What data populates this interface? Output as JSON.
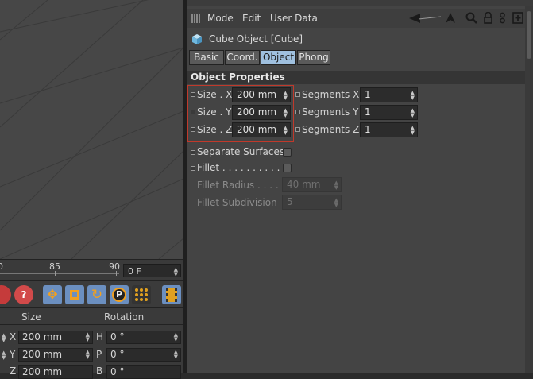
{
  "menubar": {
    "items": [
      "Mode",
      "Edit",
      "User Data"
    ]
  },
  "object_header": {
    "title": "Cube Object [Cube]"
  },
  "tabs": [
    {
      "label": "Basic",
      "active": false
    },
    {
      "label": "Coord.",
      "active": false
    },
    {
      "label": "Object",
      "active": true
    },
    {
      "label": "Phong",
      "active": false
    }
  ],
  "section": {
    "title": "Object Properties"
  },
  "size": {
    "x_label": "Size . X",
    "x_value": "200 mm",
    "y_label": "Size . Y",
    "y_value": "200 mm",
    "z_label": "Size . Z",
    "z_value": "200 mm"
  },
  "segments": {
    "x_label": "Segments X",
    "x_value": "1",
    "y_label": "Segments Y",
    "y_value": "1",
    "z_label": "Segments Z",
    "z_value": "1"
  },
  "options": {
    "separate_surfaces_label": "Separate Surfaces",
    "fillet_label": "Fillet . . . . . . . . . . . .",
    "fillet_radius_label": "Fillet Radius . . . . .",
    "fillet_radius_value": "40 mm",
    "fillet_subdivision_label": "Fillet Subdivision",
    "fillet_subdivision_value": "5"
  },
  "timeline": {
    "tick_0": "0",
    "tick_85": "85",
    "tick_90": "90",
    "current_frame": "0 F"
  },
  "coordinates": {
    "size_header": "Size",
    "rotation_header": "Rotation",
    "rows": [
      {
        "axis": "X",
        "size": "200 mm",
        "rot_label": "H",
        "rot": "0 °"
      },
      {
        "axis": "Y",
        "size": "200 mm",
        "rot_label": "P",
        "rot": "0 °"
      },
      {
        "axis": "Z",
        "size": "200 mm",
        "rot_label": "B",
        "rot": "0 °"
      }
    ]
  },
  "colors": {
    "active_tab": "#9fc0df",
    "highlight_box": "#c0392b",
    "panel_bg": "#444444"
  }
}
